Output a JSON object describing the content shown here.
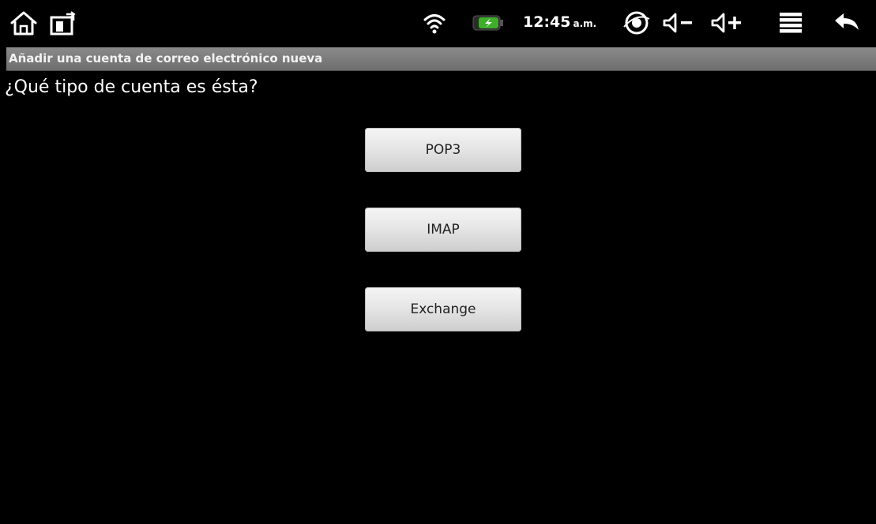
{
  "status_bar": {
    "icons": [
      {
        "name": "home-icon"
      },
      {
        "name": "screen-rotate-icon"
      },
      {
        "name": "wifi-icon"
      },
      {
        "name": "battery-charging-icon",
        "color": "#3fae2a"
      },
      {
        "name": "eye-icon"
      },
      {
        "name": "volume-down-icon"
      },
      {
        "name": "volume-up-icon"
      },
      {
        "name": "menu-icon"
      },
      {
        "name": "back-icon"
      }
    ],
    "time": "12:45",
    "ampm": "a.m."
  },
  "title_bar": {
    "title": "Añadir una cuenta de correo electrónico nueva"
  },
  "main": {
    "question": "¿Qué tipo de cuenta es ésta?",
    "buttons": [
      {
        "label": "POP3"
      },
      {
        "label": "IMAP"
      },
      {
        "label": "Exchange"
      }
    ]
  },
  "colors": {
    "background": "#000000",
    "title_bar": "#7d7d7d",
    "button": "#e6e6e6",
    "battery_accent": "#3fae2a"
  }
}
